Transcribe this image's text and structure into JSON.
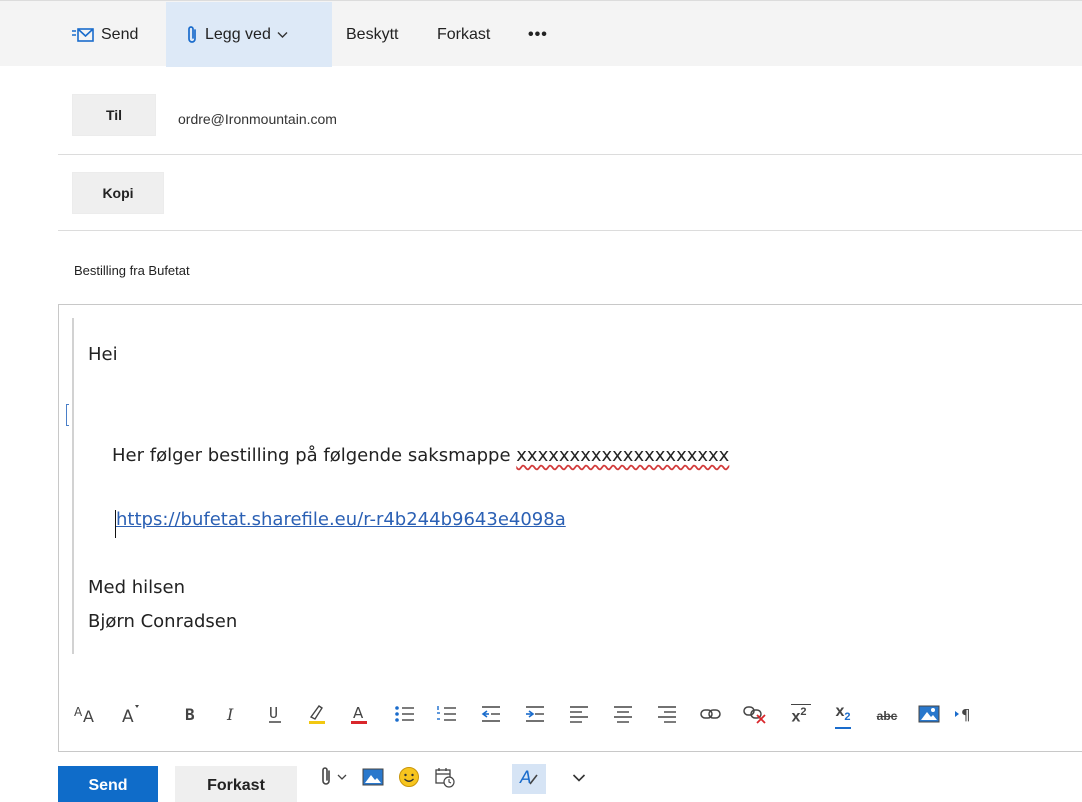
{
  "commandbar": {
    "send_label": "Send",
    "attach_label": "Legg ved",
    "protect_label": "Beskytt",
    "discard_label": "Forkast",
    "more_label": "•••"
  },
  "fields": {
    "to_label": "Til",
    "to_value": "ordre@Ironmountain.com",
    "cc_label": "Kopi",
    "subject": "Bestilling fra Bufetat"
  },
  "message": {
    "greeting": "Hei",
    "line1_prefix": "Her følger bestilling på følgende saksmappe ",
    "line1_placeholder": "xxxxxxxxxxxxxxxxxxxx",
    "link": "https://bufetat.sharefile.eu/r-r4b244b9643e4098a",
    "closing": "Med hilsen",
    "signature": "Bjørn Conradsen"
  },
  "format_toolbar": {
    "superscript_label": "x",
    "superscript_mark": "2",
    "subscript_label": "x",
    "subscript_mark": "2",
    "strikethrough_label": "abc"
  },
  "actions": {
    "send_label": "Send",
    "discard_label": "Forkast"
  },
  "colors": {
    "accent": "#0f6cc9",
    "link": "#2b60b4",
    "highlight": "#f2c811",
    "font_color": "#d9262b"
  }
}
